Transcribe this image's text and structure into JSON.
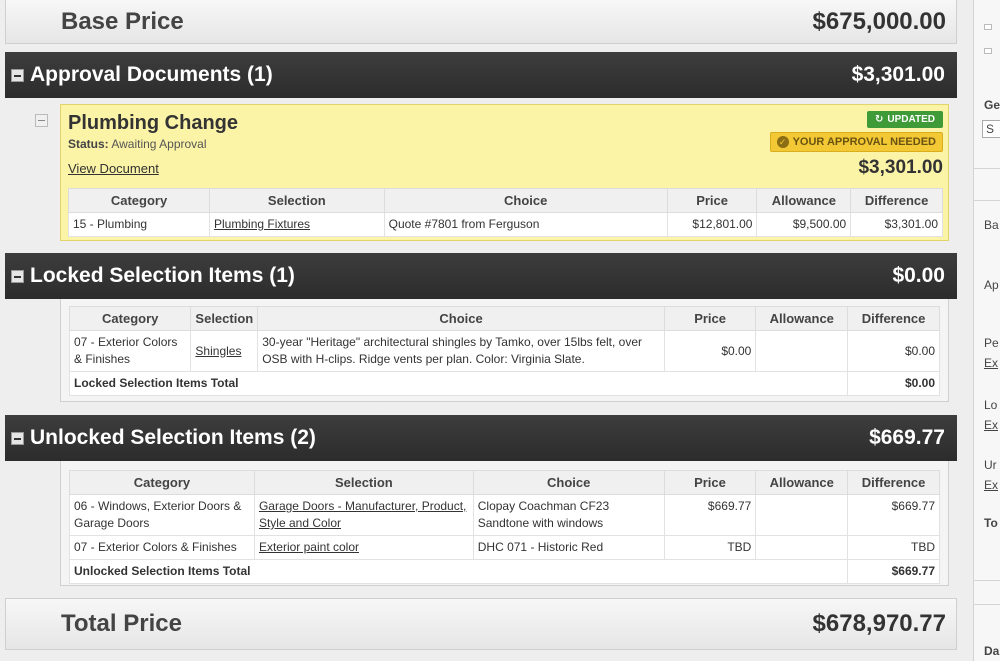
{
  "base_price": {
    "label": "Base Price",
    "value": "$675,000.00"
  },
  "approval_section": {
    "title": "Approval Documents (1)",
    "amount": "$3,301.00",
    "document": {
      "title": "Plumbing Change",
      "status_label": "Status:",
      "status_value": "Awaiting Approval",
      "view_link": "View Document",
      "badge_updated": "UPDATED",
      "badge_approval": "YOUR APPROVAL NEEDED",
      "amount": "$3,301.00",
      "columns": [
        "Category",
        "Selection",
        "Choice",
        "Price",
        "Allowance",
        "Difference"
      ],
      "rows": [
        {
          "category": "15 - Plumbing",
          "selection": "Plumbing Fixtures",
          "choice": "Quote #7801 from Ferguson",
          "price": "$12,801.00",
          "allowance": "$9,500.00",
          "difference": "$3,301.00"
        }
      ]
    }
  },
  "locked_section": {
    "title": "Locked Selection Items (1)",
    "amount": "$0.00",
    "columns": [
      "Category",
      "Selection",
      "Choice",
      "Price",
      "Allowance",
      "Difference"
    ],
    "rows": [
      {
        "category": "07 - Exterior Colors & Finishes",
        "selection": "Shingles",
        "choice": "30-year \"Heritage\" architectural shingles by Tamko, over 15lbs felt, over OSB with H-clips. Ridge vents per plan. Color: Virginia Slate.",
        "price": "$0.00",
        "allowance": "",
        "difference": "$0.00"
      }
    ],
    "total_label": "Locked Selection Items Total",
    "total_value": "$0.00"
  },
  "unlocked_section": {
    "title": "Unlocked Selection Items (2)",
    "amount": "$669.77",
    "columns": [
      "Category",
      "Selection",
      "Choice",
      "Price",
      "Allowance",
      "Difference"
    ],
    "rows": [
      {
        "category": "06 - Windows, Exterior Doors & Garage Doors",
        "selection": "Garage Doors - Manufacturer, Product, Style and Color",
        "choice": "Clopay Coachman CF23 Sandtone with windows",
        "price": "$669.77",
        "allowance": "",
        "difference": "$669.77"
      },
      {
        "category": "07 - Exterior Colors & Finishes",
        "selection": "Exterior paint color",
        "choice": "DHC 071 - Historic Red",
        "price": "TBD",
        "allowance": "",
        "difference": "TBD"
      }
    ],
    "total_label": "Unlocked Selection Items Total",
    "total_value": "$669.77"
  },
  "total_price": {
    "label": "Total Price",
    "value": "$678,970.77"
  },
  "right_panel": {
    "labels": [
      "Ge",
      "S",
      "Ba",
      "Ap",
      "Pe",
      "Ex",
      "Lo",
      "Ex",
      "Ur",
      "Ex",
      "To",
      "Da"
    ]
  },
  "colors": {
    "header_bg": "#333333",
    "approval_card_bg": "#fbf3a6",
    "updated_badge": "#3e9b37",
    "approval_badge": "#f2c834"
  }
}
